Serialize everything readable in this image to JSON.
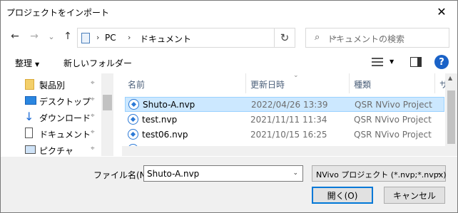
{
  "window": {
    "title": "プロジェクトをインポート",
    "close_icon": "✕"
  },
  "address": {
    "back_icon": "←",
    "forward_icon": "→",
    "recent_icon": "⌄",
    "up_icon": "↑",
    "sep1": "›",
    "pc": "PC",
    "sep2": "›",
    "documents": "ドキュメント",
    "dropdown_icon": "⌄",
    "refresh_icon": "↻"
  },
  "search": {
    "icon": "⌕",
    "placeholder": "ドキュメントの検索"
  },
  "toolbar": {
    "organize": "整理",
    "organize_dd": "▼",
    "new_folder": "新しいフォルダー",
    "view_dd": "▼",
    "help": "?"
  },
  "nav": {
    "items": [
      {
        "label": "製品別",
        "icon": "folder-icon",
        "pin": "📌"
      },
      {
        "label": "デスクトップ",
        "icon": "desktop-icon",
        "pin": "📌"
      },
      {
        "label": "ダウンロード",
        "icon": "download-icon",
        "pin": "📌"
      },
      {
        "label": "ドキュメント",
        "icon": "documents-icon",
        "pin": "📌"
      },
      {
        "label": "ピクチャ",
        "icon": "pictures-icon",
        "pin": "📌"
      }
    ]
  },
  "list": {
    "headers": {
      "name": "名前",
      "date": "更新日時",
      "type": "種類",
      "size": "サ"
    },
    "sort_icon": "⌄",
    "rows": [
      {
        "name": "Shuto-A.nvp",
        "date": "2022/04/26 13:39",
        "type": "QSR NVivo Project",
        "selected": true
      },
      {
        "name": "test.nvp",
        "date": "2021/11/11 11:34",
        "type": "QSR NVivo Project",
        "selected": false
      },
      {
        "name": "test06.nvp",
        "date": "2021/10/15 16:25",
        "type": "QSR NVivo Project",
        "selected": false
      }
    ]
  },
  "scroll": {
    "up": "▲",
    "down": "▼"
  },
  "bottom": {
    "filename_label": "ファイル名(N):",
    "filename_value": "Shuto-A.nvp",
    "filename_dd": "⌄",
    "filetype": "NVivo プロジェクト (*.nvp;*.nvpx)",
    "filetype_dd": "⌄",
    "open_button": "開く(O)",
    "cancel_button": "キャンセル"
  },
  "colors": {
    "selection": "#cce8ff",
    "selection_border": "#99d1ff",
    "accent": "#0078d7",
    "help": "#1a62c7"
  }
}
